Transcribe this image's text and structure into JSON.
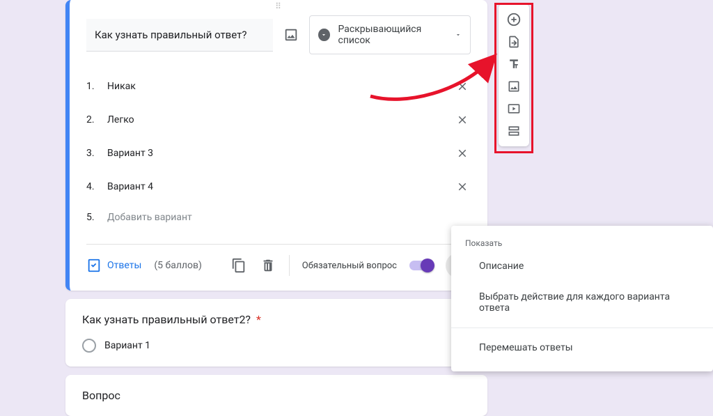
{
  "question": {
    "title": "Как узнать правильный ответ?",
    "type_label": "Раскрывающийся список",
    "options": [
      {
        "n": "1.",
        "text": "Никак",
        "has_x": true
      },
      {
        "n": "2.",
        "text": "Легко",
        "has_x": true
      },
      {
        "n": "3.",
        "text": "Вариант 3",
        "has_x": true
      },
      {
        "n": "4.",
        "text": "Вариант 4",
        "has_x": true
      },
      {
        "n": "5.",
        "text": "Добавить вариант",
        "has_x": false,
        "add": true
      }
    ],
    "answers_label": "Ответы",
    "points_label": "(5 баллов)",
    "required_label": "Обязательный вопрос"
  },
  "question2": {
    "title": "Как узнать правильный ответ2?",
    "required_mark": " *",
    "option1": "Вариант 1"
  },
  "question3": {
    "title": "Вопрос"
  },
  "context_menu": {
    "section_label": "Показать",
    "item_description": "Описание",
    "item_goto": "Выбрать действие для каждого варианта ответа",
    "item_shuffle": "Перемешать ответы"
  }
}
